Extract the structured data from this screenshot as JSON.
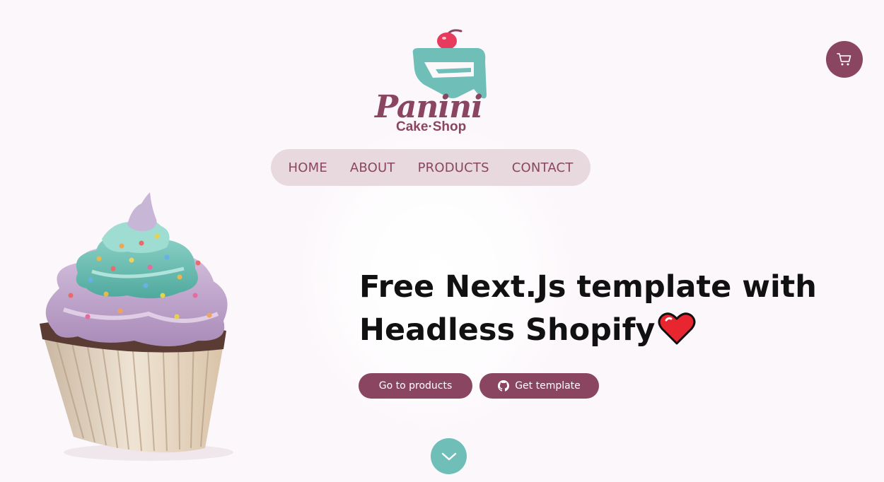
{
  "brand": {
    "name": "Panini",
    "tagline": "Cake·Shop"
  },
  "cart": {
    "icon": "cart-icon"
  },
  "nav": {
    "items": [
      {
        "label": "HOME"
      },
      {
        "label": "ABOUT"
      },
      {
        "label": "PRODUCTS"
      },
      {
        "label": "CONTACT"
      }
    ]
  },
  "hero": {
    "title_line1": "Free Next.Js template with",
    "title_line2": "Headless Shopify",
    "title_icon": "heart-icon",
    "image": "cupcake-image"
  },
  "buttons": {
    "products_label": "Go to products",
    "template_label": "Get template",
    "template_icon": "github-icon"
  },
  "scroll": {
    "icon": "chevron-down-icon"
  },
  "colors": {
    "background": "#fcf7fb",
    "primary": "#8a4660",
    "nav_background": "#e7d9de",
    "accent_teal": "#6fbfb8",
    "cherry": "#e83a5c",
    "heading": "#111111"
  }
}
